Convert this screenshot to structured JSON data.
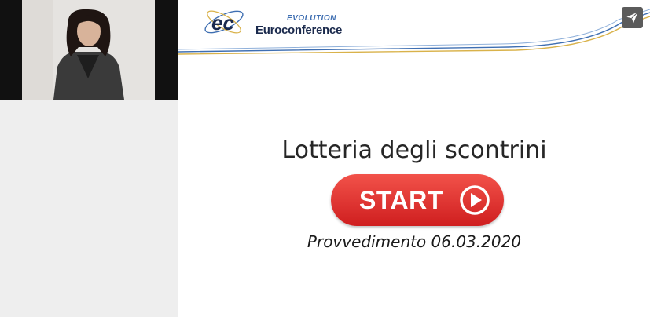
{
  "video_tile": {
    "label": "",
    "participant_icon": "person-silhouette"
  },
  "slide": {
    "logo": {
      "mark": "ec",
      "tagline": "EVOLUTION",
      "brand": "Euroconference"
    },
    "title": "Lotteria degli scontrini",
    "start_button": {
      "label": "START",
      "icon": "play-icon",
      "color": "#e2302c"
    },
    "subtitle": "Provvedimento 06.03.2020"
  },
  "toolbar": {
    "share_icon": "paper-plane-icon"
  },
  "colors": {
    "accent_blue": "#3f6fb2",
    "accent_gold": "#d9b24a",
    "start_red": "#e2302c"
  }
}
